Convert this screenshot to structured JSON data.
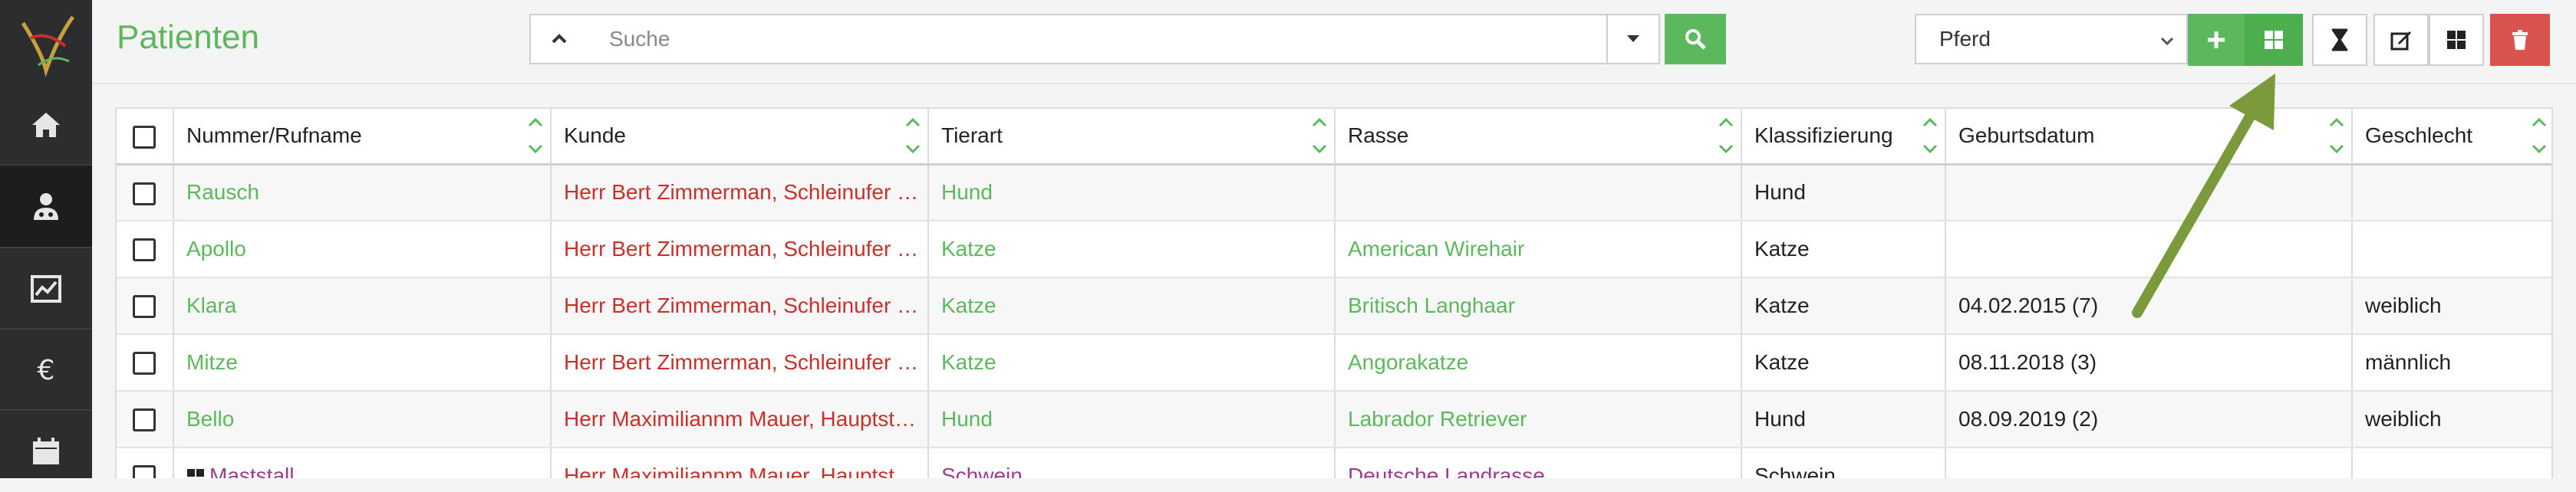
{
  "page": {
    "title": "Patienten"
  },
  "search": {
    "placeholder": "Suche"
  },
  "filter": {
    "selected": "Pferd"
  },
  "table": {
    "columns": [
      "Nummer/Rufname",
      "Kunde",
      "Tierart",
      "Rasse",
      "Klassifizierung",
      "Geburtsdatum",
      "Geschlecht"
    ],
    "rows": [
      {
        "name": "Rausch",
        "kunde": "Herr Bert Zimmerman, Schleinufer …",
        "tierart": "Hund",
        "rasse": "",
        "klass": "Hund",
        "geburt": "",
        "geschlecht": ""
      },
      {
        "name": "Apollo",
        "kunde": "Herr Bert Zimmerman, Schleinufer …",
        "tierart": "Katze",
        "rasse": "American Wirehair",
        "klass": "Katze",
        "geburt": "",
        "geschlecht": ""
      },
      {
        "name": "Klara",
        "kunde": "Herr Bert Zimmerman, Schleinufer …",
        "tierart": "Katze",
        "rasse": "Britisch Langhaar",
        "klass": "Katze",
        "geburt": "04.02.2015 (7)",
        "geschlecht": "weiblich"
      },
      {
        "name": "Mitze",
        "kunde": "Herr Bert Zimmerman, Schleinufer …",
        "tierart": "Katze",
        "rasse": "Angorakatze",
        "klass": "Katze",
        "geburt": "08.11.2018 (3)",
        "geschlecht": "männlich"
      },
      {
        "name": "Bello",
        "kunde": "Herr Maximiliannm Mauer, Hauptst…",
        "tierart": "Hund",
        "rasse": "Labrador Retriever",
        "klass": "Hund",
        "geburt": "08.09.2019 (2)",
        "geschlecht": "weiblich"
      },
      {
        "name": "Maststall",
        "kunde": "Herr Maximiliannm Mauer, Hauptst…",
        "tierart": "Schwein",
        "rasse": "Deutsche Landrasse",
        "klass": "Schwein",
        "geburt": "",
        "geschlecht": ""
      }
    ]
  },
  "colors": {
    "accent": "#5cb85c",
    "customer": "#c9302c",
    "group": "#9b3d8e",
    "danger": "#d9534f",
    "sidebar": "#2b2d2f",
    "arrow": "#7a9a3c"
  },
  "icons": [
    "logo-icon",
    "home-icon",
    "patients-icon",
    "chart-icon",
    "euro-icon",
    "calendar-icon",
    "chevron-up-icon",
    "caret-down-icon",
    "search-icon",
    "plus-icon",
    "grid-icon",
    "hourglass-icon",
    "edit-icon",
    "trash-icon",
    "sort-icon",
    "group-icon"
  ]
}
